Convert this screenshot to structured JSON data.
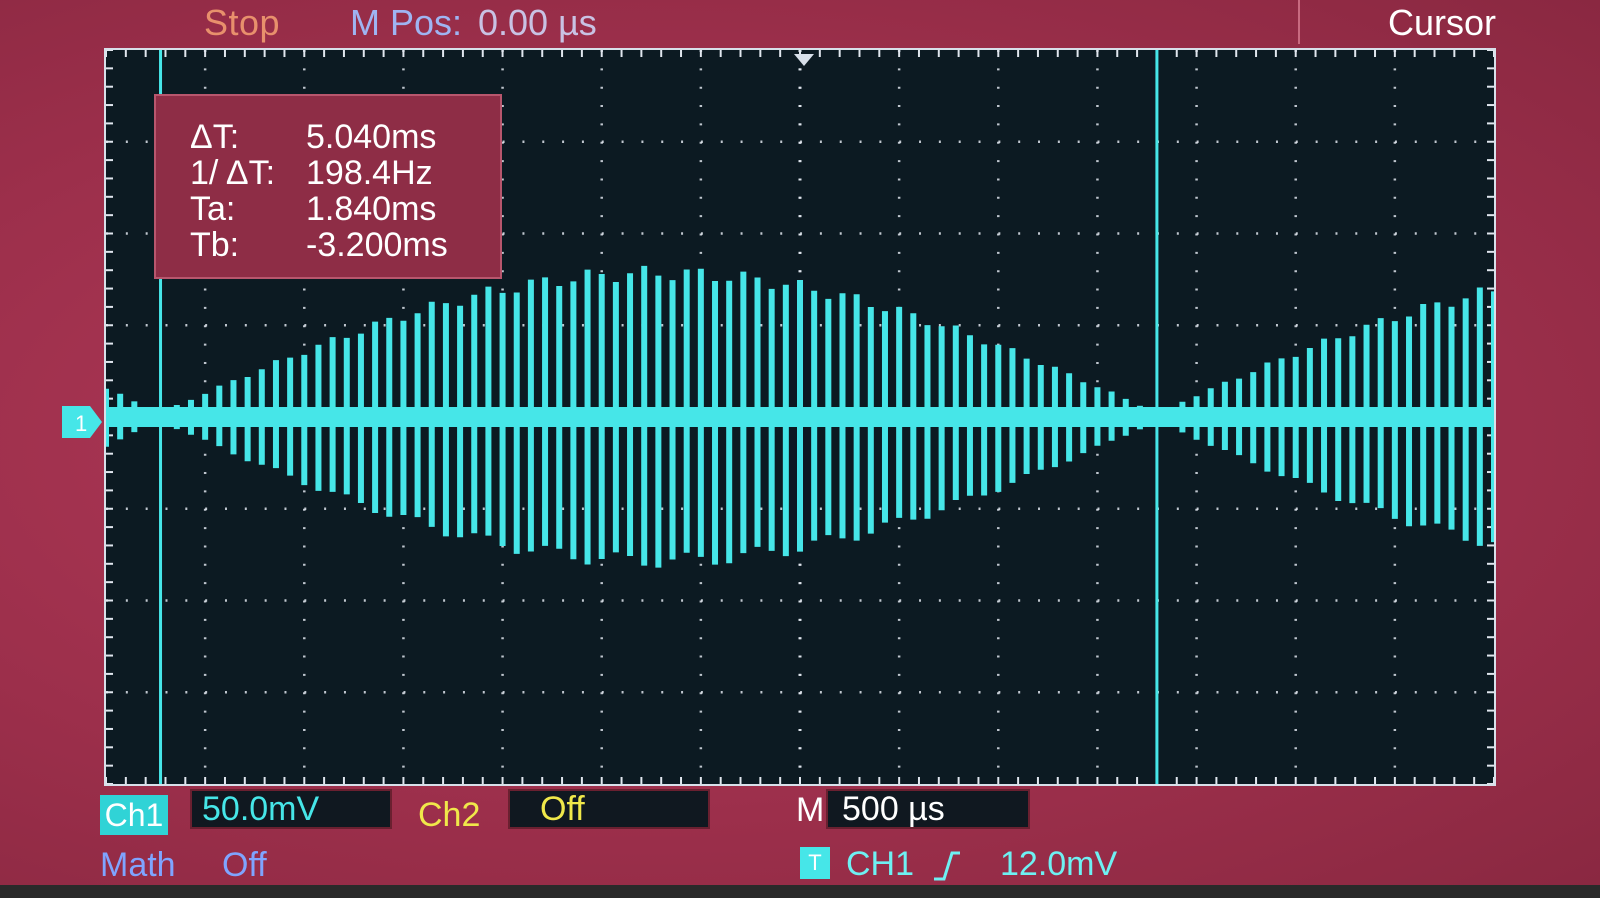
{
  "header": {
    "run_state": "Stop",
    "mpos_label": "M Pos:",
    "mpos_value": "0.00 µs",
    "menu_title": "Cursor"
  },
  "cursor_readout": {
    "rows": [
      {
        "label": "ΔT:",
        "value": "5.040ms"
      },
      {
        "label": "1/ ΔT:",
        "value": "198.4Hz"
      },
      {
        "label": "Ta:",
        "value": "1.840ms"
      },
      {
        "label": "Tb:",
        "value": "-3.200ms"
      }
    ]
  },
  "channel_marker": "1",
  "footer": {
    "ch1_label": "Ch1",
    "ch1_scale": "50.0mV",
    "ch2_label": "Ch2",
    "ch2_scale": "Off",
    "timebase_prefix": "M",
    "timebase_value": "500 µs",
    "math_label": "Math",
    "math_value": "Off",
    "trigger_icon": "T",
    "trigger_source": "CH1",
    "trigger_edge_icon": "rising-edge-icon",
    "trigger_level": "12.0mV"
  },
  "colors": {
    "trace": "#46e6e8",
    "grid_dots": "#e0e6ee",
    "frame": "#a1344f"
  },
  "chart_data": {
    "type": "line",
    "grid_divisions": {
      "x": 14,
      "y": 8
    },
    "time_per_div": "500 µs",
    "volts_per_div": "50.0mV",
    "carrier_spikes_per_div": 7,
    "envelope_max_div": 1.65,
    "envelope_null_div": 0.05,
    "envelope_null_x_div": [
      0.55,
      10.6
    ],
    "cursor_a_div": 0.55,
    "cursor_b_div": 10.6
  }
}
